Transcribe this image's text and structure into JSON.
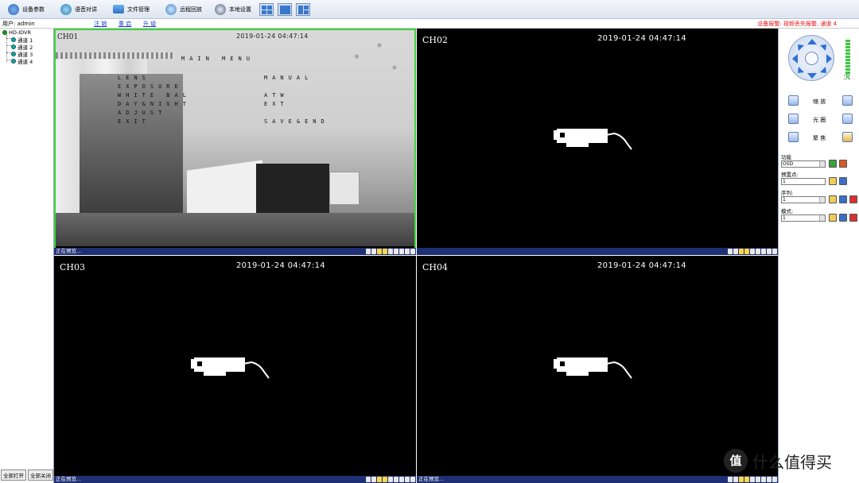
{
  "toolbar": {
    "items": [
      {
        "label": "设备参数",
        "icon": "device-settings-icon"
      },
      {
        "label": "语音对讲",
        "icon": "voice-intercom-icon"
      },
      {
        "label": "文件管理",
        "icon": "folder-icon"
      },
      {
        "label": "远程回放",
        "icon": "remote-playback-icon"
      },
      {
        "label": "本地设置",
        "icon": "local-settings-icon"
      }
    ],
    "layouts": [
      "layout-4-icon",
      "layout-1-icon",
      "layout-split-icon"
    ]
  },
  "userbar": {
    "user": "用户: admin",
    "logout": "注 销",
    "restart": "重 启",
    "update": "升 级",
    "alarm": "设备报警: 视频丢失报警, 通道 4"
  },
  "tree": {
    "root": "HD-IDVR",
    "channels": [
      "通道 1",
      "通道 2",
      "通道 3",
      "通道 4"
    ],
    "open_all": "全部打开",
    "close_all": "全部关闭"
  },
  "cells": [
    {
      "label": "CH01",
      "timestamp": "2019-01-24  04:47:14",
      "status": "正在预览..."
    },
    {
      "label": "CH02",
      "timestamp": "2019-01-24  04:47:14",
      "status": "正在预览..."
    },
    {
      "label": "CH03",
      "timestamp": "2019-01-24  04:47:14",
      "status": "正在预览..."
    },
    {
      "label": "CH04",
      "timestamp": "2019-01-24  04:47:14",
      "status": "正在预览..."
    }
  ],
  "osd": {
    "title": "MAIN MENU",
    "left": [
      "LENS",
      "EXPOSURE",
      "WHITE BAL",
      "DAY&NIGHT",
      "ADJUST",
      "EXIT"
    ],
    "right": [
      "MANUAL",
      "ATW",
      "EXT",
      "SAVE&END"
    ]
  },
  "right": {
    "zoom_label": "缩 放",
    "iris_label": "光 圈",
    "focus_label": "聚 焦",
    "function_label": "功能",
    "function_value": "OSD",
    "preset_label": "预置点:",
    "preset_value": "1",
    "sequence_label": "序列:",
    "sequence_value": "1",
    "pattern_label": "模式:",
    "pattern_value": "1"
  },
  "watermark": {
    "logo": "值",
    "text": "什么值得买"
  },
  "colors": {
    "selected": "#3ad43a",
    "statusbar": "#1f2f73",
    "alarm": "#e01010",
    "link": "#1a3cc6"
  }
}
